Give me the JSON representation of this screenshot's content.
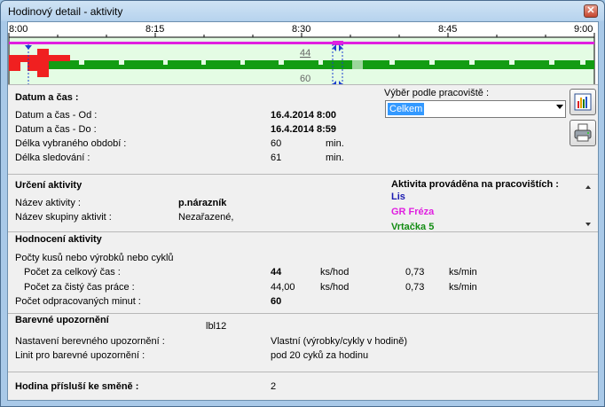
{
  "window": {
    "title": "Hodinový detail - aktivity",
    "close_glyph": "✕"
  },
  "timeline": {
    "ticks": [
      "8:00",
      "8:15",
      "8:30",
      "8:45",
      "9:00"
    ],
    "marker_top": "44",
    "marker_bottom": "60",
    "colors": {
      "green": "#139c13",
      "red": "#f02020",
      "magenta": "#e020e0",
      "light_green": "#e4fce4",
      "blue": "#1a3dcf"
    }
  },
  "datetime": {
    "heading": "Datum a čas :",
    "from_label": "Datum a čas - Od :",
    "from_value": "16.4.2014 8:00",
    "to_label": "Datum a čas - Do :",
    "to_value": "16.4.2014 8:59",
    "period_label": "Délka vybraného období :",
    "period_value": "60",
    "period_unit": "min.",
    "tracking_label": "Délka sledování :",
    "tracking_value": "61",
    "tracking_unit": "min."
  },
  "workplace_select": {
    "label": "Výběr podle pracoviště :",
    "value": "Celkem"
  },
  "toolbar": {
    "chart_icon": "bar-chart-icon",
    "print_icon": "printer-icon"
  },
  "activity": {
    "heading": "Určení aktivity",
    "name_label": "Název aktivity :",
    "name_value": "p.nárazník",
    "group_label": "Název skupiny aktivit :",
    "group_value": "Nezařazené,",
    "workplaces_heading": "Aktivita prováděna na pracovištích :",
    "workplaces": [
      {
        "name": "Lis",
        "color": "#1a1ab0"
      },
      {
        "name": "GR Fréza",
        "color": "#e020e0"
      },
      {
        "name": "Vrtačka 5",
        "color": "#138c13"
      }
    ]
  },
  "evaluation": {
    "heading": "Hodnocení aktivity",
    "count_label": "Počty kusů nebo výrobků nebo cyklů",
    "total_label": "Počet za celkový čas :",
    "total_value": "44",
    "total_unit": "ks/hod",
    "total_min_value": "0,73",
    "total_min_unit": "ks/min",
    "net_label": "Počet za čistý čas práce :",
    "net_value": "44,00",
    "net_unit": "ks/hod",
    "net_min_value": "0,73",
    "net_min_unit": "ks/min",
    "minutes_label": "Počet odpracovaných minut :",
    "minutes_value": "60"
  },
  "color_warning": {
    "heading": "Barevné upozornění",
    "lbl": "lbl12",
    "setting_label": "Nastavení berevného upozornění :",
    "setting_value": "Vlastní (výrobky/cykly v hodině)",
    "limit_label": "Linit pro barevné upozornění :",
    "limit_value": "pod 20 cyků za hodinu"
  },
  "shift": {
    "label": "Hodina přísluší ke směně :",
    "value": "2"
  }
}
